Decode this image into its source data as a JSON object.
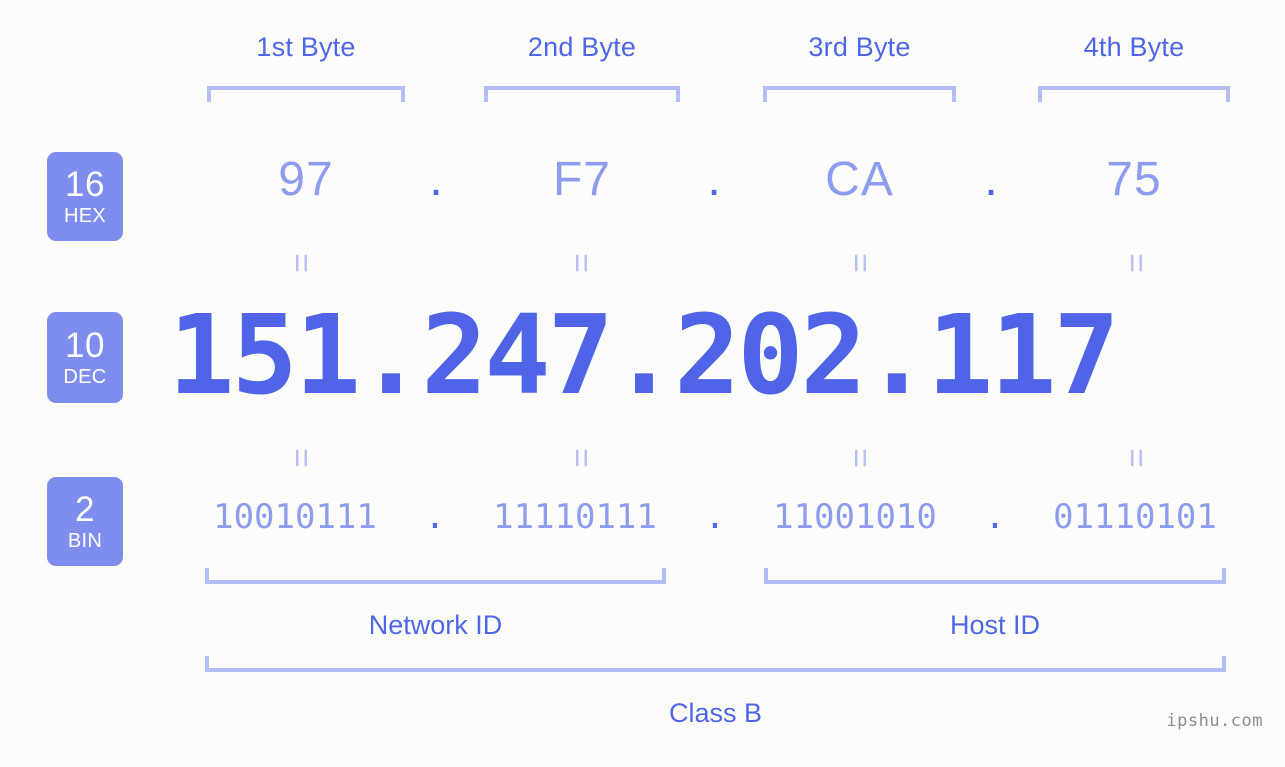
{
  "ip": {
    "decimal": "151.247.202.117",
    "hex": "97.F7.CA.75",
    "binary": "10010111.11110111.11001010.01110101",
    "class": "Class B"
  },
  "header": {
    "bytes": [
      {
        "label": "1st Byte"
      },
      {
        "label": "2nd Byte"
      },
      {
        "label": "3rd Byte"
      },
      {
        "label": "4th Byte"
      }
    ]
  },
  "bases": [
    {
      "num": "16",
      "name": "HEX"
    },
    {
      "num": "10",
      "name": "DEC"
    },
    {
      "num": "2",
      "name": "BIN"
    }
  ],
  "rows": {
    "hex": {
      "values": [
        "97",
        "F7",
        "CA",
        "75"
      ],
      "separator": "."
    },
    "dec": {
      "text": "151.247.202.117"
    },
    "bin": {
      "values": [
        "10010111",
        "11110111",
        "11001010",
        "01110101"
      ],
      "separator": "."
    }
  },
  "equals": {
    "glyph": "="
  },
  "sections": {
    "network_id": "Network ID",
    "host_id": "Host ID",
    "class": "Class B"
  },
  "watermark": "ipshu.com",
  "colors": {
    "background": "#fcfdfa",
    "accent_strong": "#4f66e8",
    "accent_dec": "#5064e8",
    "accent_light": "#8e9cef",
    "bracket": "#b3bdf7",
    "badge_bg": "#7f8eee",
    "badge_text": "#ffffff",
    "watermark": "#8d8d8d"
  }
}
